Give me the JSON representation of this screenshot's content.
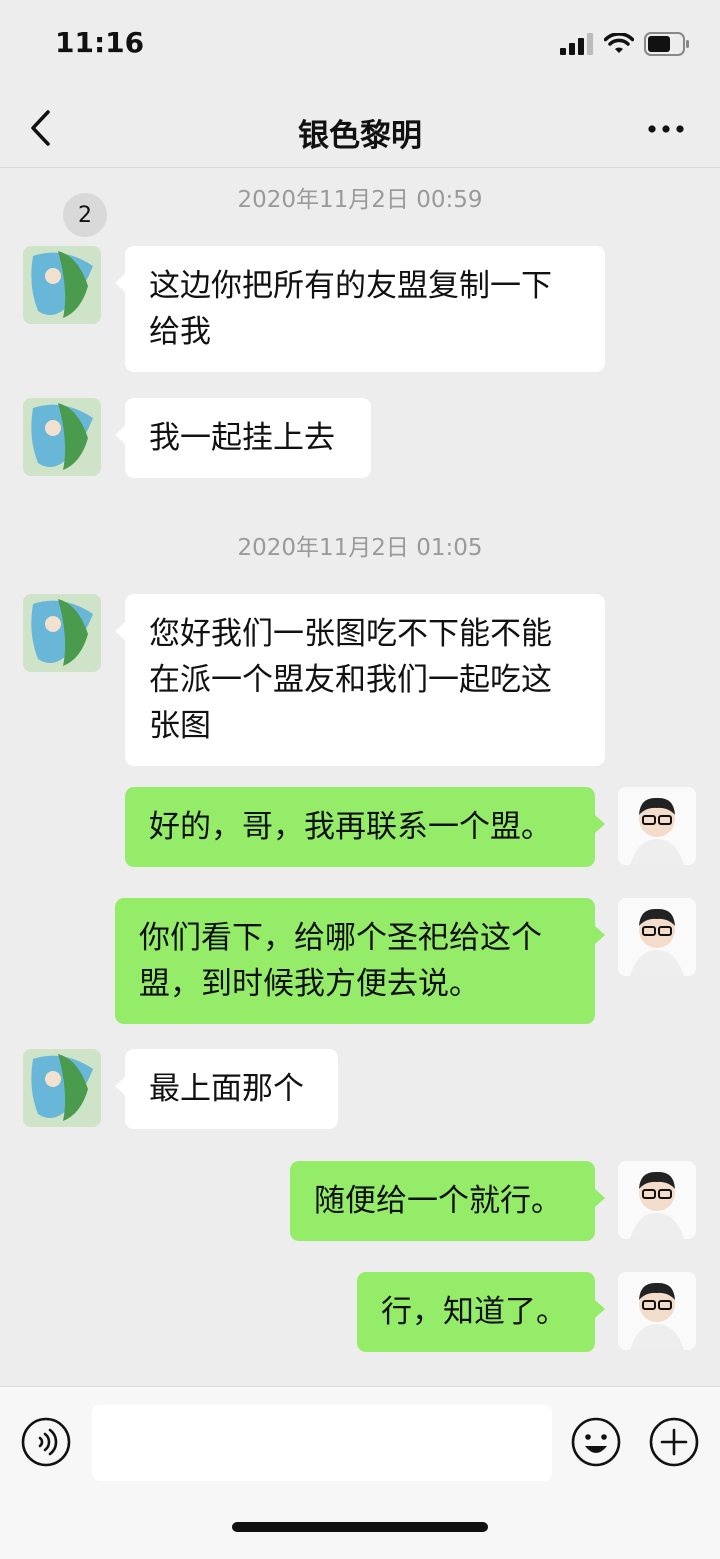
{
  "status_bar": {
    "time": "11:16"
  },
  "header": {
    "back_badge": "2",
    "title": "银色黎明"
  },
  "timestamps": [
    "2020年11月2日 00:59",
    "2020年11月2日 01:05"
  ],
  "messages": [
    {
      "side": "left",
      "text": "这边你把所有的友盟复制一下给我"
    },
    {
      "side": "left",
      "text": "我一起挂上去"
    },
    {
      "side": "left",
      "text": "您好我们一张图吃不下能不能在派一个盟友和我们一起吃这张图"
    },
    {
      "side": "right",
      "text": "好的，哥，我再联系一个盟。"
    },
    {
      "side": "right",
      "text": "你们看下，给哪个圣祀给这个盟，到时候我方便去说。"
    },
    {
      "side": "left",
      "text": "最上面那个"
    },
    {
      "side": "right",
      "text": "随便给一个就行。"
    },
    {
      "side": "right",
      "text": "行，知道了。"
    }
  ],
  "colors": {
    "background": "#ededed",
    "bubble_left": "#ffffff",
    "bubble_right": "#95ec69"
  },
  "icons": [
    "signal-icon",
    "wifi-icon",
    "battery-icon",
    "back-icon",
    "more-icon",
    "voice-icon",
    "emoji-icon",
    "plus-icon"
  ]
}
